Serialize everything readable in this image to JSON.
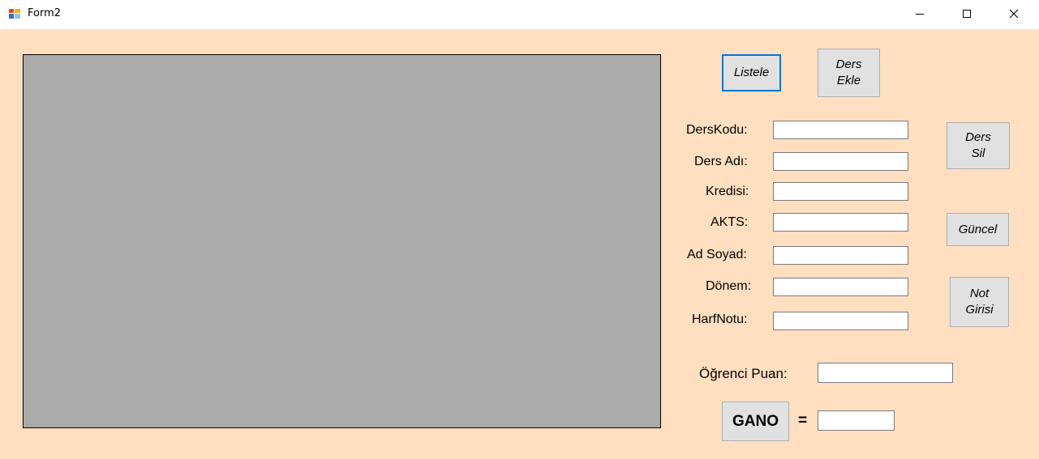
{
  "window": {
    "title": "Form2",
    "controls": {
      "minimize": "minimize",
      "maximize": "maximize",
      "close": "close"
    }
  },
  "buttons": {
    "listele": "Listele",
    "ders_ekle": "Ders\nEkle",
    "ders_sil": "Ders\nSil",
    "guncel": "Güncel",
    "not_girisi": "Not\nGirisi",
    "gano": "GANO"
  },
  "fields": {
    "ders_kodu": {
      "label": "DersKodu:",
      "value": ""
    },
    "ders_adi": {
      "label": "Ders Adı:",
      "value": ""
    },
    "kredisi": {
      "label": "Kredisi:",
      "value": ""
    },
    "akts": {
      "label": "AKTS:",
      "value": ""
    },
    "ad_soyad": {
      "label": "Ad Soyad:",
      "value": ""
    },
    "donem": {
      "label": "Dönem:",
      "value": ""
    },
    "harf_notu": {
      "label": "HarfNotu:",
      "value": ""
    },
    "ogrenci_puan": {
      "label": "Öğrenci Puan:",
      "value": ""
    },
    "gano_result": {
      "value": ""
    }
  },
  "gano_equals": "=",
  "colors": {
    "form_background": "#ffdfc0",
    "grid_background": "#ababab",
    "button_face": "#e1e1e1",
    "focus_border": "#0078d7"
  }
}
